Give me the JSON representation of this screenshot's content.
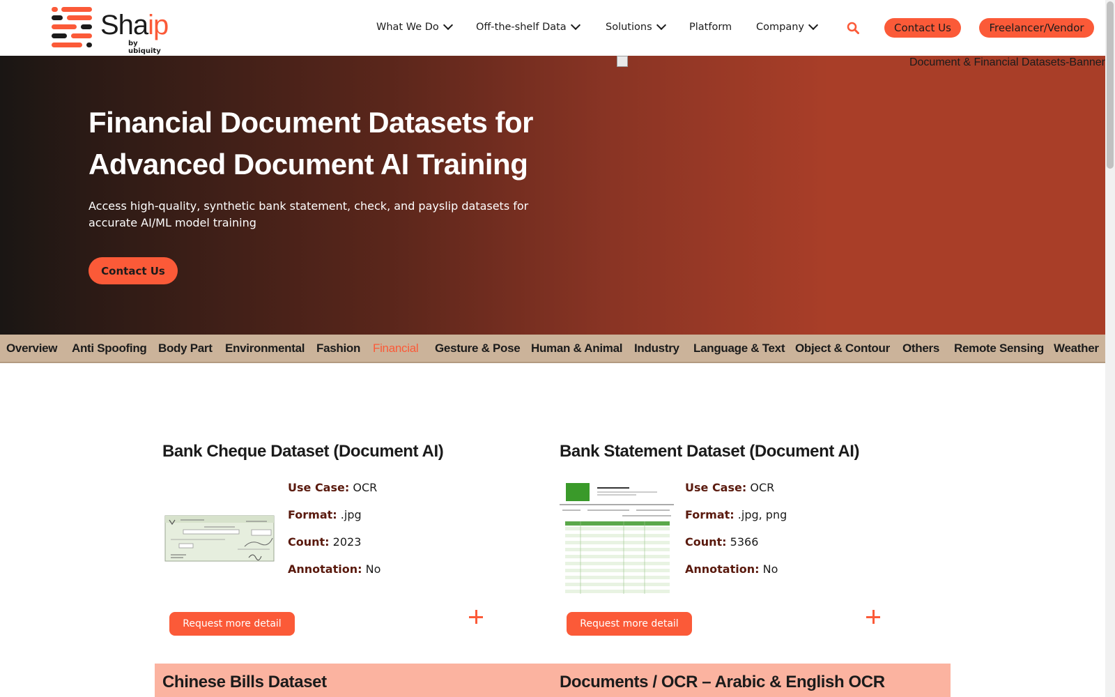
{
  "header": {
    "logo": {
      "word_main": "Sha",
      "word_accent": "ip",
      "sub": "by ubiquity"
    },
    "nav": [
      {
        "label": "What We Do",
        "dropdown": true
      },
      {
        "label": "Off-the-shelf Data",
        "dropdown": true
      },
      {
        "label": "Solutions",
        "dropdown": true
      },
      {
        "label": "Platform",
        "dropdown": false
      },
      {
        "label": "Company",
        "dropdown": true
      }
    ],
    "contact_label": "Contact Us",
    "vendor_label": "Freelancer/Vendor",
    "accent_color": "#fb5a38"
  },
  "hero": {
    "banner_alt": "Document & Financial Datasets-Banner",
    "title": "Financial Document Datasets for Advanced Document AI Training",
    "subtitle": "Access high-quality, synthetic bank statement, check, and payslip datasets for accurate AI/ML model training",
    "cta_label": "Contact Us"
  },
  "tabs": [
    {
      "label": "Overview",
      "active": false
    },
    {
      "label": "Anti Spoofing",
      "active": false
    },
    {
      "label": "Body Part",
      "active": false
    },
    {
      "label": "Environmental",
      "active": false
    },
    {
      "label": "Fashion",
      "active": false
    },
    {
      "label": "Financial",
      "active": true
    },
    {
      "label": "Gesture & Pose",
      "active": false
    },
    {
      "label": "Human & Animal",
      "active": false
    },
    {
      "label": "Industry",
      "active": false
    },
    {
      "label": "Language & Text",
      "active": false
    },
    {
      "label": "Object & Contour",
      "active": false
    },
    {
      "label": "Others",
      "active": false
    },
    {
      "label": "Remote Sensing",
      "active": false
    },
    {
      "label": "Weather",
      "active": false
    }
  ],
  "datasets": [
    {
      "title": "Bank Cheque Dataset (Document AI)",
      "use_case_label": "Use Case:",
      "use_case": "OCR",
      "format_label": "Format:",
      "format": ".jpg",
      "count_label": "Count:",
      "count": "2023",
      "annotation_label": "Annotation:",
      "annotation": "No",
      "request_label": "Request more detail"
    },
    {
      "title": "Bank Statement Dataset (Document AI)",
      "use_case_label": "Use Case:",
      "use_case": "OCR",
      "format_label": "Format:",
      "format": ".jpg, png",
      "count_label": "Count:",
      "count": "5366",
      "annotation_label": "Annotation:",
      "annotation": "No",
      "request_label": "Request more detail"
    }
  ],
  "next_row": {
    "left_title": "Chinese Bills Dataset",
    "right_title": "Documents / OCR – Arabic & English OCR"
  }
}
